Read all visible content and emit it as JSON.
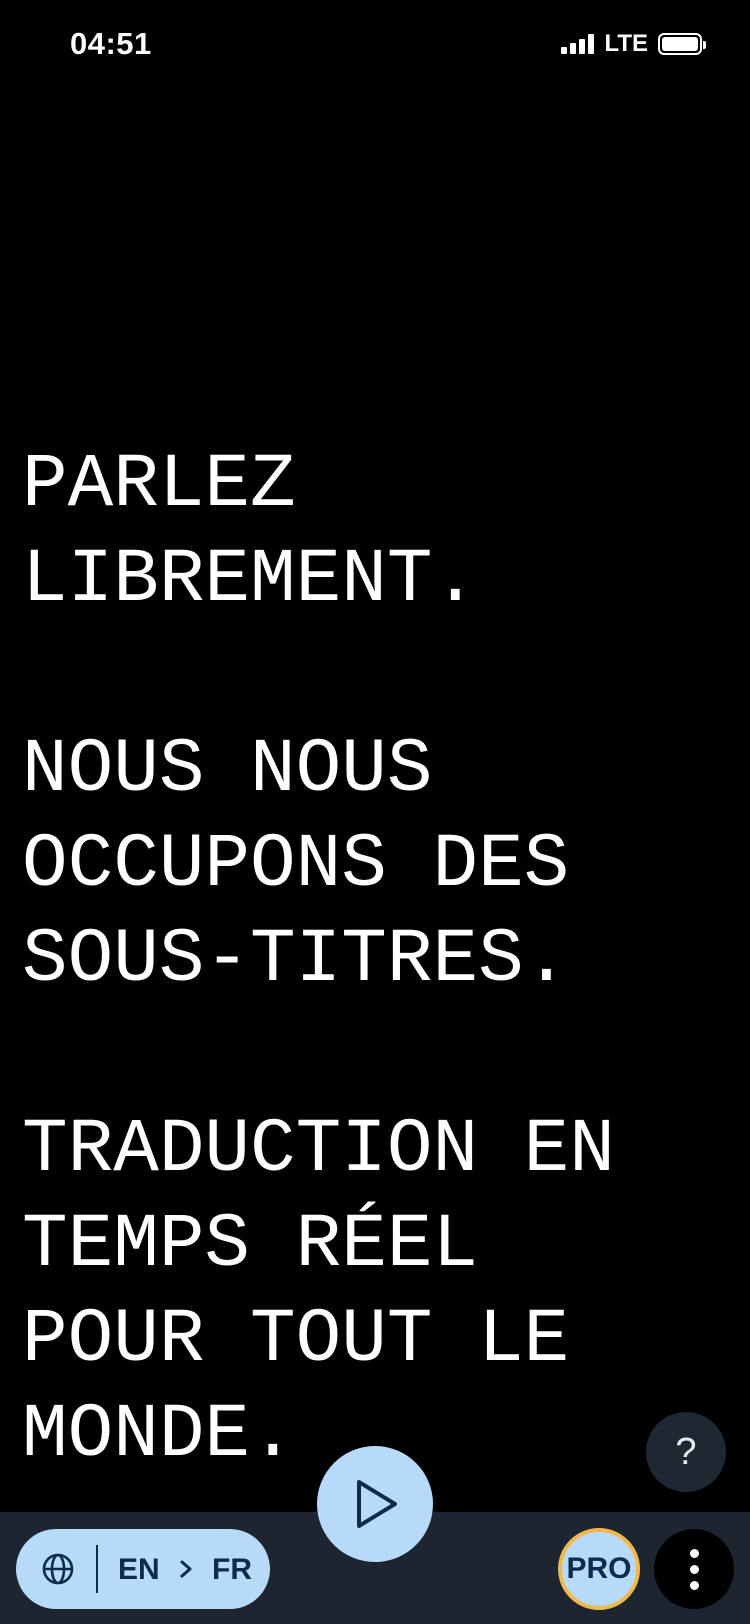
{
  "status_bar": {
    "time": "04:51",
    "network": "LTE",
    "battery_level": 1.0
  },
  "caption": {
    "text": "PARLEZ\nLIBREMENT.\n\nNOUS NOUS\nOCCUPONS DES\nSOUS-TITRES.\n\nTRADUCTION EN\nTEMPS RÉEL\nPOUR TOUT LE\nMONDE."
  },
  "help_button": {
    "label": "?"
  },
  "language_selector": {
    "icon": "globe-icon",
    "from": "EN",
    "to": "FR"
  },
  "play_button": {
    "icon": "play-icon"
  },
  "pro_button": {
    "label": "PRO"
  },
  "menu_button": {
    "icon": "more-vertical-icon"
  },
  "colors": {
    "background": "#000000",
    "bottom_bar": "#1d2530",
    "accent": "#b7daf9",
    "pro_ring": "#f2b84b",
    "help_bg": "#1e2833"
  }
}
